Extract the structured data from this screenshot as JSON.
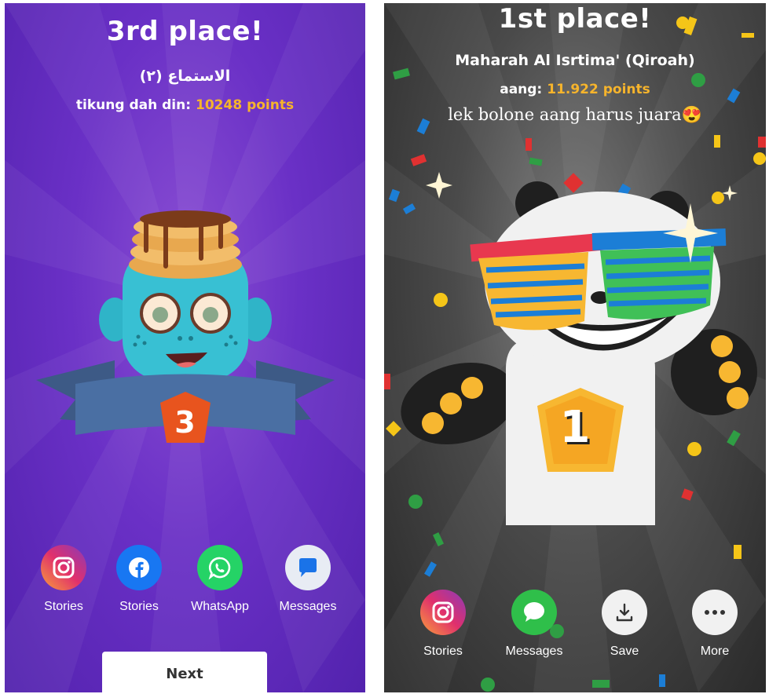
{
  "left": {
    "title": "3rd place!",
    "subtitle": "الاستماع (٢)",
    "points_label": "tikung dah din:",
    "points_value": "10248 points",
    "rank": "3",
    "share": [
      {
        "label": "Stories",
        "icon": "instagram-icon"
      },
      {
        "label": "Stories",
        "icon": "facebook-icon"
      },
      {
        "label": "WhatsApp",
        "icon": "whatsapp-icon"
      },
      {
        "label": "Messages",
        "icon": "messages-icon"
      }
    ],
    "next_label": "Next"
  },
  "right": {
    "title": "1st place!",
    "subtitle": "Maharah Al Isrtima' (Qiroah)",
    "points_label": "aang:",
    "points_value": "11.922 points",
    "caption": "lek bolone aang harus juara😍",
    "rank": "1",
    "share": [
      {
        "label": "Stories",
        "icon": "instagram-icon"
      },
      {
        "label": "Messages",
        "icon": "messages-icon"
      },
      {
        "label": "Save",
        "icon": "download-icon"
      },
      {
        "label": "More",
        "icon": "more-dots-icon"
      }
    ]
  },
  "colors": {
    "accent_points": "#f6b42c",
    "left_bg": "#6a30c6",
    "right_bg": "#4a4a4a",
    "whatsapp": "#25d366",
    "facebook": "#1877f2"
  }
}
